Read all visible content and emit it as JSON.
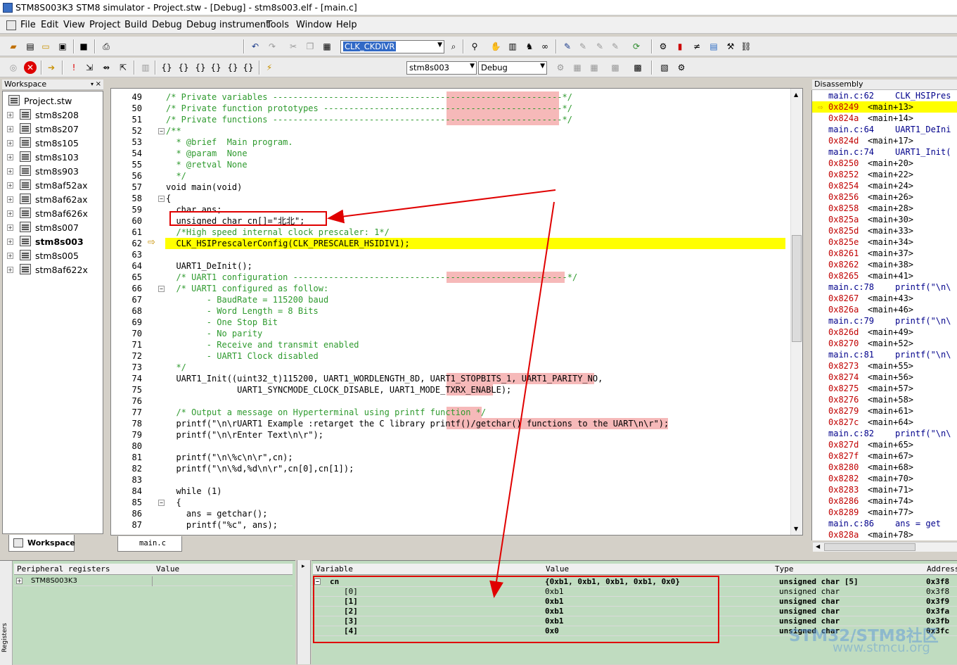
{
  "window": {
    "title": "STM8S003K3 STM8 simulator - Project.stw - [Debug] - stm8s003.elf - [main.c]"
  },
  "menu": [
    "File",
    "Edit",
    "View",
    "Project",
    "Build",
    "Debug",
    "Debug instrument",
    "Tools",
    "Window",
    "Help"
  ],
  "toolbar": {
    "symbol_combo": "CLK_CKDIVR",
    "target_combo": "stm8s003",
    "config_combo": "Debug"
  },
  "workspace": {
    "header": "Workspace",
    "root": "Project.stw",
    "items": [
      "stm8s208",
      "stm8s207",
      "stm8s105",
      "stm8s103",
      "stm8s903",
      "stm8af52ax",
      "stm8af62ax",
      "stm8af626x",
      "stm8s007",
      "stm8s003",
      "stm8s005",
      "stm8af622x"
    ],
    "active_item": "stm8s003",
    "tab_label": "Workspace"
  },
  "editor": {
    "tab_label": "main.c",
    "current_line": 62,
    "lines": [
      {
        "n": "49",
        "t": "/* Private variables ---------------------------------------------------------*/"
      },
      {
        "n": "50",
        "t": "/* Private function prototypes -----------------------------------------------*/"
      },
      {
        "n": "51",
        "t": "/* Private functions ---------------------------------------------------------*/"
      },
      {
        "n": "52",
        "t": "/**"
      },
      {
        "n": "53",
        "t": "  * @brief  Main program."
      },
      {
        "n": "54",
        "t": "  * @param  None"
      },
      {
        "n": "55",
        "t": "  * @retval None"
      },
      {
        "n": "56",
        "t": "  */"
      },
      {
        "n": "57",
        "t": "void main(void)"
      },
      {
        "n": "58",
        "t": "{"
      },
      {
        "n": "59",
        "t": "  char ans;"
      },
      {
        "n": "60",
        "t": "  unsigned char cn[]=\"北北\";"
      },
      {
        "n": "61",
        "t": "  /*High speed internal clock prescaler: 1*/"
      },
      {
        "n": "62",
        "t": "  CLK_HSIPrescalerConfig(CLK_PRESCALER_HSIDIV1);"
      },
      {
        "n": "63",
        "t": ""
      },
      {
        "n": "64",
        "t": "  UART1_DeInit();"
      },
      {
        "n": "65",
        "t": "  /* UART1 configuration ------------------------------------------------------*/"
      },
      {
        "n": "66",
        "t": "  /* UART1 configured as follow:"
      },
      {
        "n": "67",
        "t": "        - BaudRate = 115200 baud"
      },
      {
        "n": "68",
        "t": "        - Word Length = 8 Bits"
      },
      {
        "n": "69",
        "t": "        - One Stop Bit"
      },
      {
        "n": "70",
        "t": "        - No parity"
      },
      {
        "n": "71",
        "t": "        - Receive and transmit enabled"
      },
      {
        "n": "72",
        "t": "        - UART1 Clock disabled"
      },
      {
        "n": "73",
        "t": "  */"
      },
      {
        "n": "74",
        "t": "  UART1_Init((uint32_t)115200, UART1_WORDLENGTH_8D, UART1_STOPBITS_1, UART1_PARITY_NO,"
      },
      {
        "n": "75",
        "t": "              UART1_SYNCMODE_CLOCK_DISABLE, UART1_MODE_TXRX_ENABLE);"
      },
      {
        "n": "76",
        "t": ""
      },
      {
        "n": "77",
        "t": "  /* Output a message on Hyperterminal using printf function */"
      },
      {
        "n": "78",
        "t": "  printf(\"\\n\\rUART1 Example :retarget the C library printf()/getchar() functions to the UART\\n\\r\");"
      },
      {
        "n": "79",
        "t": "  printf(\"\\n\\rEnter Text\\n\\r\");"
      },
      {
        "n": "80",
        "t": ""
      },
      {
        "n": "81",
        "t": "  printf(\"\\n\\%c\\n\\r\",cn);"
      },
      {
        "n": "82",
        "t": "  printf(\"\\n\\%d,%d\\n\\r\",cn[0],cn[1]);"
      },
      {
        "n": "83",
        "t": ""
      },
      {
        "n": "84",
        "t": "  while (1)"
      },
      {
        "n": "85",
        "t": "  {"
      },
      {
        "n": "86",
        "t": "    ans = getchar();"
      },
      {
        "n": "87",
        "t": "    printf(\"%c\", ans);"
      }
    ]
  },
  "disassembly": {
    "header": "Disassembly",
    "current_addr": "0x8249",
    "rows": [
      {
        "a": "main.c:62",
        "s": "CLK_HSIPres",
        "src": true
      },
      {
        "a": "0x8249",
        "s": "<main+13>"
      },
      {
        "a": "0x824a",
        "s": "<main+14>"
      },
      {
        "a": "main.c:64",
        "s": "UART1_DeIni",
        "src": true
      },
      {
        "a": "0x824d",
        "s": "<main+17>"
      },
      {
        "a": "main.c:74",
        "s": "UART1_Init(",
        "src": true
      },
      {
        "a": "0x8250",
        "s": "<main+20>"
      },
      {
        "a": "0x8252",
        "s": "<main+22>"
      },
      {
        "a": "0x8254",
        "s": "<main+24>"
      },
      {
        "a": "0x8256",
        "s": "<main+26>"
      },
      {
        "a": "0x8258",
        "s": "<main+28>"
      },
      {
        "a": "0x825a",
        "s": "<main+30>"
      },
      {
        "a": "0x825d",
        "s": "<main+33>"
      },
      {
        "a": "0x825e",
        "s": "<main+34>"
      },
      {
        "a": "0x8261",
        "s": "<main+37>"
      },
      {
        "a": "0x8262",
        "s": "<main+38>"
      },
      {
        "a": "0x8265",
        "s": "<main+41>"
      },
      {
        "a": "main.c:78",
        "s": "printf(\"\\n\\",
        "src": true
      },
      {
        "a": "0x8267",
        "s": "<main+43>"
      },
      {
        "a": "0x826a",
        "s": "<main+46>"
      },
      {
        "a": "main.c:79",
        "s": "printf(\"\\n\\",
        "src": true
      },
      {
        "a": "0x826d",
        "s": "<main+49>"
      },
      {
        "a": "0x8270",
        "s": "<main+52>"
      },
      {
        "a": "main.c:81",
        "s": "printf(\"\\n\\",
        "src": true
      },
      {
        "a": "0x8273",
        "s": "<main+55>"
      },
      {
        "a": "0x8274",
        "s": "<main+56>"
      },
      {
        "a": "0x8275",
        "s": "<main+57>"
      },
      {
        "a": "0x8276",
        "s": "<main+58>"
      },
      {
        "a": "0x8279",
        "s": "<main+61>"
      },
      {
        "a": "0x827c",
        "s": "<main+64>"
      },
      {
        "a": "main.c:82",
        "s": "printf(\"\\n\\",
        "src": true
      },
      {
        "a": "0x827d",
        "s": "<main+65>"
      },
      {
        "a": "0x827f",
        "s": "<main+67>"
      },
      {
        "a": "0x8280",
        "s": "<main+68>"
      },
      {
        "a": "0x8282",
        "s": "<main+70>"
      },
      {
        "a": "0x8283",
        "s": "<main+71>"
      },
      {
        "a": "0x8286",
        "s": "<main+74>"
      },
      {
        "a": "0x8289",
        "s": "<main+77>"
      },
      {
        "a": "main.c:86",
        "s": "ans = get",
        "src": true
      },
      {
        "a": "0x828a",
        "s": "<main+78>"
      }
    ]
  },
  "registers": {
    "side_label": "Registers",
    "col_name": "Peripheral registers",
    "col_value": "Value",
    "root": "STM8S003K3"
  },
  "watch": {
    "col_variable": "Variable",
    "col_value": "Value",
    "col_type": "Type",
    "col_address": "Address",
    "rows": [
      {
        "var": "cn",
        "val": "{0xb1, 0xb1, 0xb1, 0xb1, 0x0}",
        "type": "unsigned char [5]",
        "addr": "0x3f8",
        "bold": true
      },
      {
        "var": "[0]",
        "val": "0xb1",
        "type": "unsigned char",
        "addr": "0x3f8",
        "bold": false
      },
      {
        "var": "[1]",
        "val": "0xb1",
        "type": "unsigned char",
        "addr": "0x3f9",
        "bold": true
      },
      {
        "var": "[2]",
        "val": "0xb1",
        "type": "unsigned char",
        "addr": "0x3fa",
        "bold": true
      },
      {
        "var": "[3]",
        "val": "0xb1",
        "type": "unsigned char",
        "addr": "0x3fb",
        "bold": true
      },
      {
        "var": "[4]",
        "val": "0x0",
        "type": "unsigned char",
        "addr": "0x3fc",
        "bold": true
      }
    ]
  },
  "watermark": {
    "line1": "STM32/STM8社区",
    "line2": "www.stmcu.org"
  },
  "colors": {
    "highlight": "#ffff00",
    "annotation_red": "#e00000",
    "watch_bg": "#c0dcc0",
    "pink": "#f6b9b9"
  }
}
